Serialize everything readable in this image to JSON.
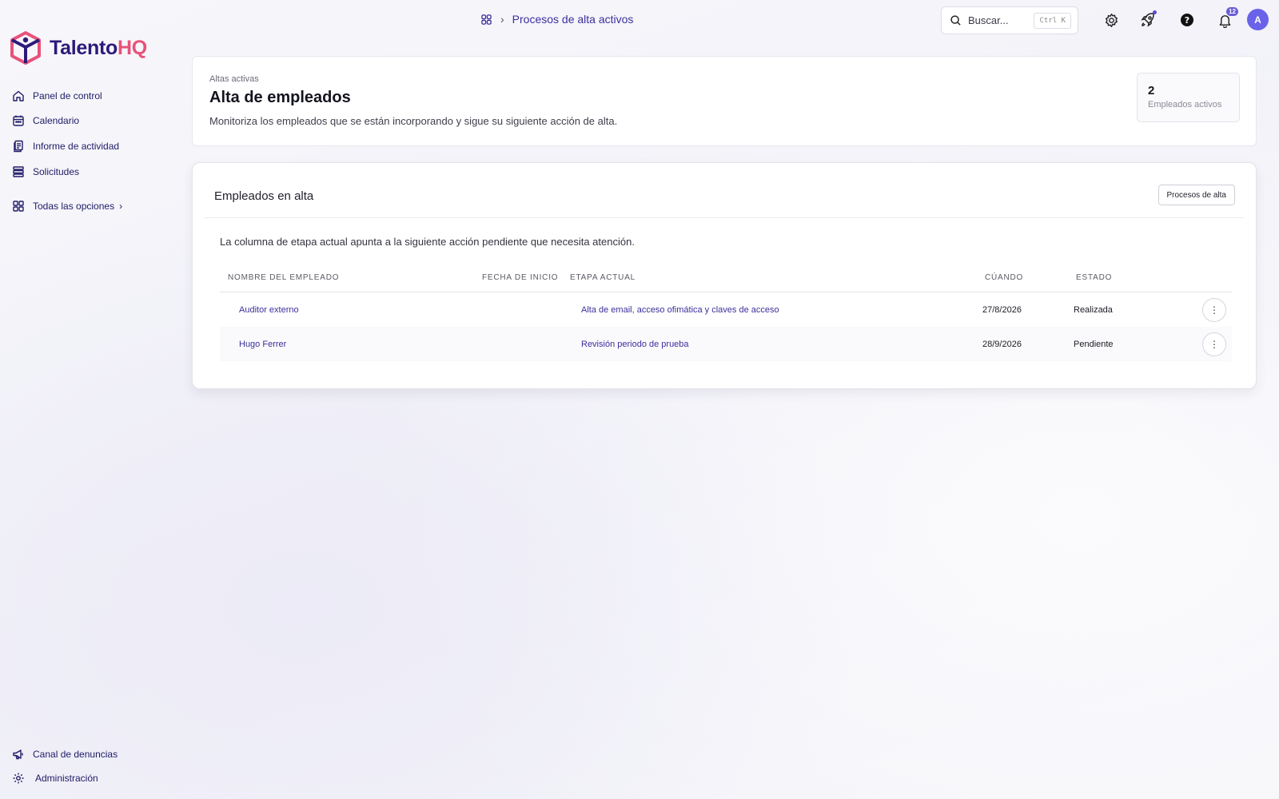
{
  "brand": {
    "name_a": "Talento",
    "name_b": "HQ"
  },
  "sidebar": {
    "items": [
      {
        "label": "Panel de control",
        "icon": "home-icon"
      },
      {
        "label": "Calendario",
        "icon": "calendar-icon"
      },
      {
        "label": "Informe de actividad",
        "icon": "report-icon"
      },
      {
        "label": "Solicitudes",
        "icon": "list-icon"
      },
      {
        "label": "Todas las opciones",
        "icon": "grid-icon"
      }
    ],
    "footer": [
      {
        "label": "Canal de denuncias",
        "icon": "megaphone-icon"
      },
      {
        "label": "Administración",
        "icon": "gear-icon"
      }
    ]
  },
  "topbar": {
    "breadcrumb": "Procesos de alta activos",
    "search_placeholder": "Buscar...",
    "search_shortcut": "Ctrl K",
    "notifications_count": "12",
    "avatar_initial": "A"
  },
  "header": {
    "eyebrow": "Altas activas",
    "title": "Alta de empleados",
    "subtitle": "Monitoriza los empleados que se están incorporando y sigue su siguiente acción de alta.",
    "stat_value": "2",
    "stat_label": "Empleados activos"
  },
  "table_card": {
    "title": "Empleados en alta",
    "button": "Procesos de alta",
    "note": "La columna de etapa actual apunta a la siguiente acción pendiente que necesita atención.",
    "columns": [
      "NOMBRE DEL EMPLEADO",
      "FECHA DE INICIO",
      "ETAPA ACTUAL",
      "CÚANDO",
      "ESTADO"
    ],
    "rows": [
      {
        "name": "Auditor externo",
        "start": "",
        "stage": "Alta de email, acceso ofimática y claves de acceso",
        "when": "27/8/2026",
        "status": "Realizada"
      },
      {
        "name": "Hugo Ferrer",
        "start": "",
        "stage": "Revisión periodo de prueba",
        "when": "28/9/2026",
        "status": "Pendiente"
      }
    ]
  },
  "colors": {
    "accent": "#3b2f9c",
    "brand_pink": "#e8527a",
    "avatar": "#6a62e8"
  }
}
